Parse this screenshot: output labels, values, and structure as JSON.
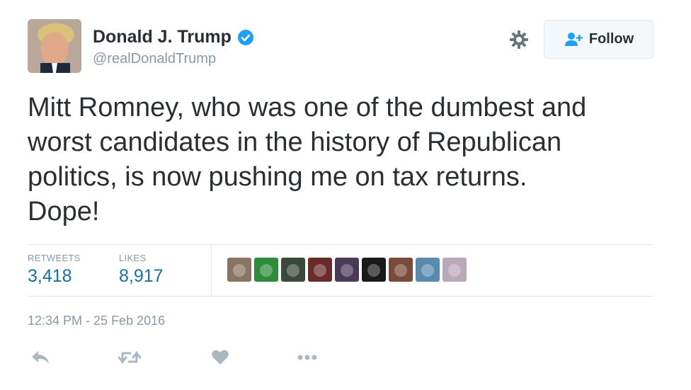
{
  "user": {
    "name": "Donald J. Trump",
    "handle": "@realDonaldTrump",
    "verified": true
  },
  "follow_button": {
    "label": "Follow"
  },
  "tweet": {
    "lines": [
      "Mitt Romney, who was one of the dumbest and",
      "worst candidates in the history of Republican",
      "politics, is now pushing me on tax returns.",
      "Dope!"
    ]
  },
  "stats": {
    "retweets_label": "RETWEETS",
    "retweets_value": "3,418",
    "likes_label": "LIKES",
    "likes_value": "8,917"
  },
  "likers": [
    {
      "color": "#8a7563"
    },
    {
      "color": "#2e8b3a"
    },
    {
      "color": "#3a4a3a"
    },
    {
      "color": "#6b2a2a"
    },
    {
      "color": "#4a3a5a"
    },
    {
      "color": "#1a1a1a"
    },
    {
      "color": "#7a4a3a"
    },
    {
      "color": "#5a8ab0"
    },
    {
      "color": "#b8a8b8"
    }
  ],
  "timestamp": "12:34 PM - 25 Feb 2016",
  "actions": {
    "reply_icon": "reply-icon",
    "retweet_icon": "retweet-icon",
    "like_icon": "heart-icon",
    "more_icon": "more-icon"
  },
  "colors": {
    "text": "#292f33",
    "muted": "#8899a6",
    "link": "#1b6fa1",
    "verified": "#1da1f2",
    "border": "#e1e8ed"
  }
}
